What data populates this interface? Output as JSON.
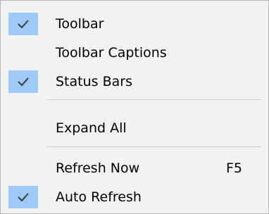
{
  "menu": {
    "items": [
      {
        "label": "Toolbar",
        "checked": true,
        "icon": "checkmark-icon"
      },
      {
        "label": "Toolbar Captions",
        "checked": false
      },
      {
        "label": "Status Bars",
        "checked": true,
        "icon": "checkmark-icon"
      },
      {
        "label": "Expand All",
        "checked": false
      },
      {
        "label": "Refresh Now",
        "checked": false,
        "shortcut": "F5"
      },
      {
        "label": "Auto Refresh",
        "checked": true,
        "icon": "checkmark-icon"
      }
    ]
  },
  "colors": {
    "menu_background": "#f2f2f2",
    "check_highlight": "#9dcaf6",
    "checkmark": "#3a3a3a",
    "separator": "#cccccc",
    "border": "#b7b7b7"
  }
}
